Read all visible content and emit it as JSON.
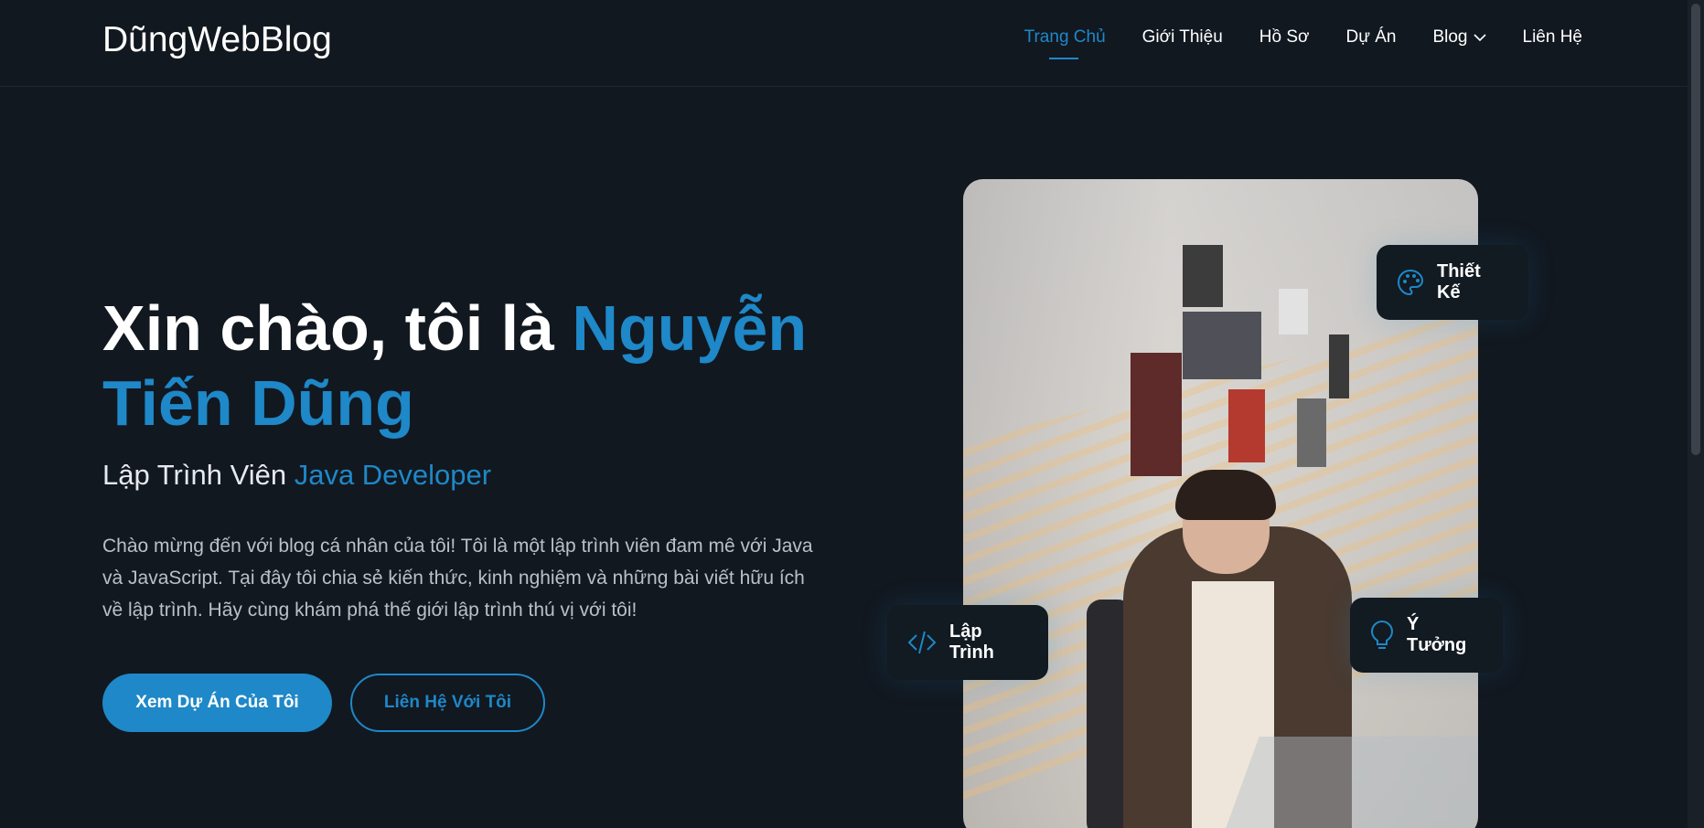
{
  "header": {
    "logo": "DũngWebBlog",
    "nav": [
      {
        "label": "Trang Chủ",
        "active": true
      },
      {
        "label": "Giới Thiệu"
      },
      {
        "label": "Hồ Sơ"
      },
      {
        "label": "Dự Án"
      },
      {
        "label": "Blog"
      },
      {
        "label": "Liên Hệ"
      }
    ]
  },
  "hero": {
    "title_prefix": "Xin chào, tôi là ",
    "title_name": "Nguyễn Tiến Dũng",
    "subtitle_prefix": "Lập Trình Viên ",
    "subtitle_role": "Java Developer",
    "description": "Chào mừng đến với blog cá nhân của tôi! Tôi là một lập trình viên đam mê với Java và JavaScript. Tại đây tôi chia sẻ kiến thức, kinh nghiệm và những bài viết hữu ích về lập trình. Hãy cùng khám phá thế giới lập trình thú vị với tôi!",
    "primary_button": "Xem Dự Án Của Tôi",
    "secondary_button": "Liên Hệ Với Tôi"
  },
  "chips": {
    "design": {
      "label": "Thiết Kế",
      "icon": "palette-icon"
    },
    "code": {
      "label": "Lập Trình",
      "icon": "code-icon"
    },
    "idea": {
      "label": "Ý Tưởng",
      "icon": "lightbulb-icon"
    }
  },
  "colors": {
    "background": "#121820",
    "accent": "#1e88c8",
    "text": "#ffffff",
    "muted": "#b9c0ca"
  }
}
